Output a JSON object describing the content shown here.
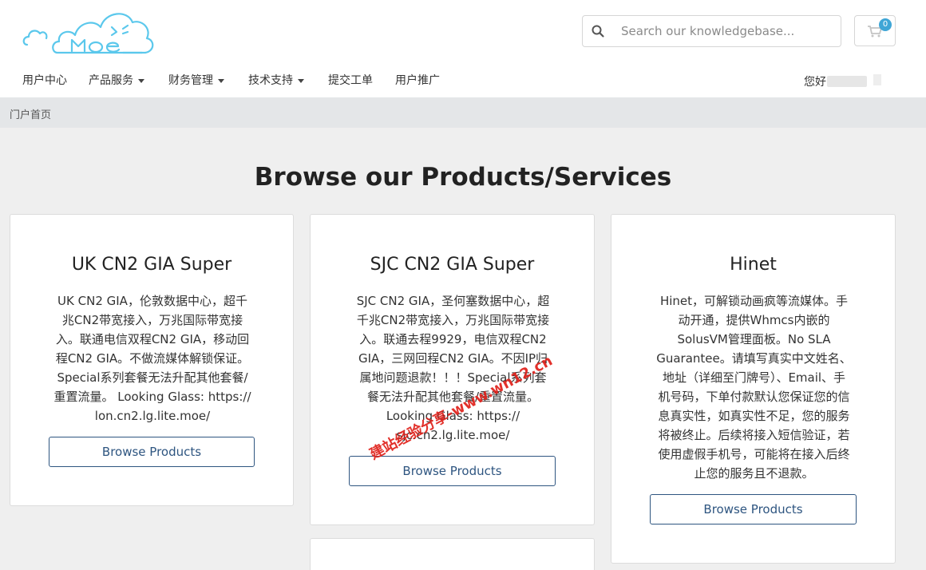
{
  "header": {
    "search": {
      "placeholder": "Search our knowledgebase..."
    },
    "cart": {
      "count": "0"
    },
    "greeting": "您好"
  },
  "nav": {
    "items": [
      {
        "label": "用户中心"
      },
      {
        "label": "产品服务"
      },
      {
        "label": "财务管理"
      },
      {
        "label": "技术支持"
      },
      {
        "label": "提交工单"
      },
      {
        "label": "用户推广"
      }
    ]
  },
  "breadcrumb": {
    "home": "门户首页"
  },
  "page": {
    "title": "Browse our Products/Services"
  },
  "products": [
    {
      "name": "UK CN2 GIA Super",
      "desc_lines": [
        "UK CN2 GIA，伦敦数据中心，超千",
        "兆CN2带宽接入，万兆国际带宽接",
        "入。联通电信双程CN2 GIA，移动回",
        "程CN2 GIA。不做流媒体解锁保证。",
        "Special系列套餐无法升配其他套餐/",
        "重置流量。 Looking Glass: https://",
        "lon.cn2.lg.lite.moe/"
      ],
      "button": "Browse Products"
    },
    {
      "name": "SJC CN2 GIA Super",
      "desc_lines": [
        "SJC CN2 GIA，圣何塞数据中心，超",
        "千兆CN2带宽接入，万兆国际带宽接",
        "入。联通去程9929，电信双程CN2",
        "GIA，三网回程CN2 GIA。不因IP归",
        "属地问题退款！！！Special系列套",
        "餐无法升配其他套餐/重置流量。",
        "Looking Glass: https://",
        "sjc.cn2.lg.lite.moe/"
      ],
      "button": "Browse Products"
    },
    {
      "name": "Hinet",
      "desc_lines": [
        "Hinet，可解锁动画疯等流媒体。手",
        "动开通，提供Whmcs内嵌的",
        "SolusVM管理面板。No SLA",
        "Guarantee。请填写真实中文姓名、",
        "地址（详细至门牌号）、Email、手",
        "机号码，下单付款默认您保证您的信",
        "息真实性，如真实性不足，您的服务",
        "将被终止。后续将接入短信验证，若",
        "使用虚假手机号，可能将在接入后终",
        "止您的服务且不退款。"
      ],
      "button": "Browse Products"
    }
  ],
  "watermark": "建站经验分享-www.wn12.cn",
  "colors": {
    "accent": "#2e5580",
    "badge": "#3fa6d6",
    "logo": "#5bc8ec",
    "watermark": "#e0201a"
  }
}
